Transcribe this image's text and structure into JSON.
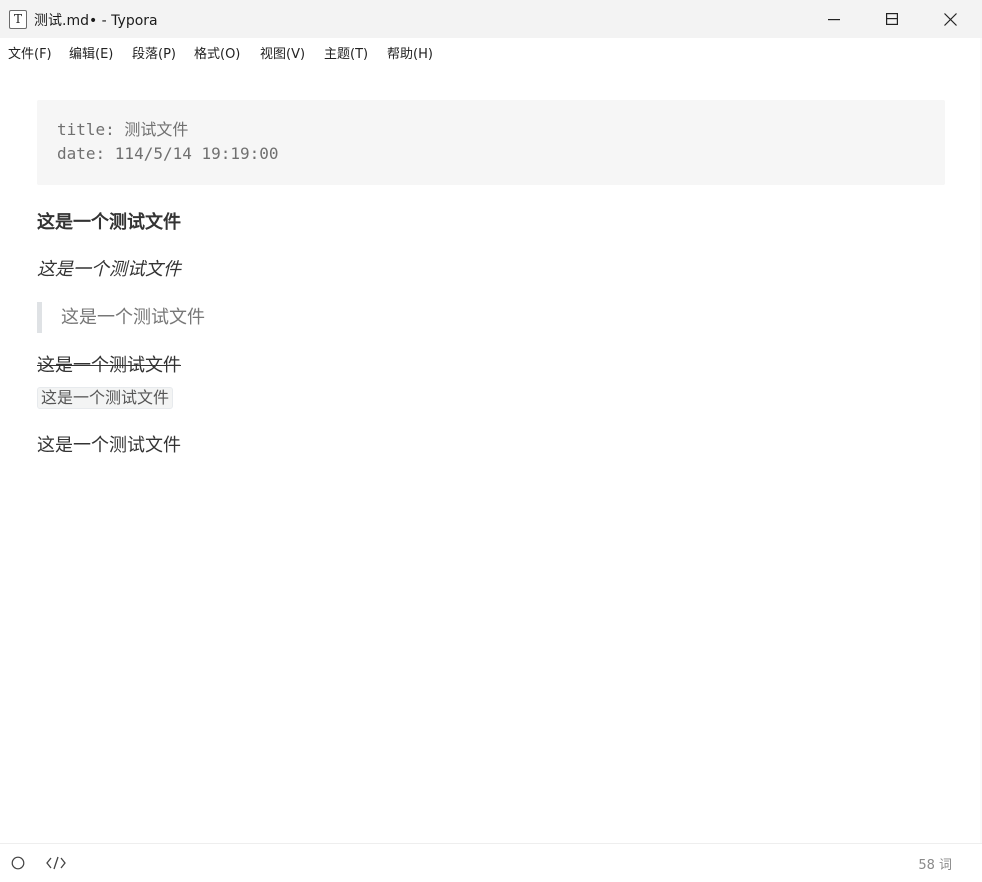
{
  "window": {
    "app_icon": "T",
    "title": "测试.md• - Typora",
    "controls": [
      "minimize-icon",
      "maximize-icon",
      "close-icon"
    ]
  },
  "menu": {
    "items": [
      "文件(F)",
      "编辑(E)",
      "段落(P)",
      "格式(O)",
      "视图(V)",
      "主题(T)",
      "帮助(H)"
    ]
  },
  "document": {
    "front_matter": {
      "title_line": "title: 测试文件",
      "date_line": "date: 114/5/14 19:19:00"
    },
    "bold_text": "这是一个测试文件",
    "italic_text": "这是一个测试文件",
    "blockquote_text": "这是一个测试文件",
    "strikethrough_text": "这是一个测试文件",
    "inline_code_text": "这是一个测试文件",
    "plain_text": "这是一个测试文件"
  },
  "status": {
    "left_icons": [
      "circle-outline-icon",
      "source-code-icon"
    ],
    "word_count": "58 词"
  }
}
